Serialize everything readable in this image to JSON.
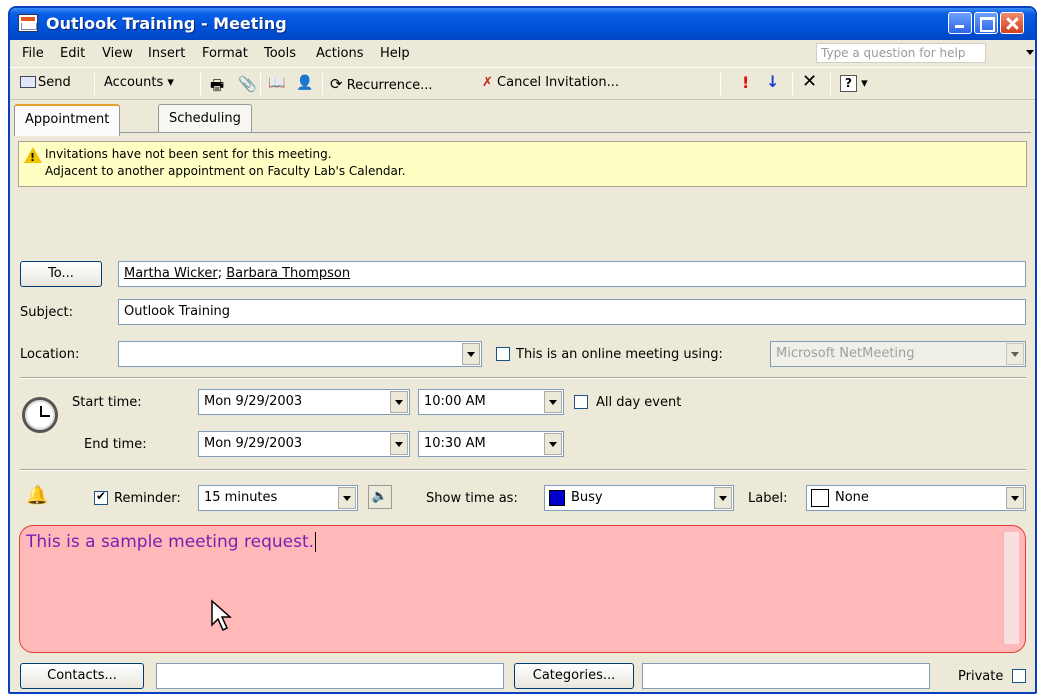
{
  "window": {
    "title": "Outlook Training - Meeting"
  },
  "menu": [
    "File",
    "Edit",
    "View",
    "Insert",
    "Format",
    "Tools",
    "Actions",
    "Help"
  ],
  "help_placeholder": "Type a question for help",
  "toolbar": {
    "send": "Send",
    "accounts": "Accounts",
    "recurrence": "Recurrence...",
    "cancel_invitation": "Cancel Invitation..."
  },
  "tabs": [
    "Appointment",
    "Scheduling"
  ],
  "info": {
    "line1": "Invitations have not been sent for this meeting.",
    "line2": "Adjacent to another appointment on Faculty Lab's Calendar."
  },
  "to": {
    "button": "To...",
    "recipients": [
      "Martha Wicker",
      "Barbara Thompson"
    ]
  },
  "subject": {
    "label": "Subject:",
    "value": "Outlook Training"
  },
  "location": {
    "label": "Location:",
    "value": "",
    "online_label": "This is an online meeting using:",
    "online_service": "Microsoft NetMeeting"
  },
  "start": {
    "label": "Start time:",
    "date": "Mon 9/29/2003",
    "time": "10:00 AM"
  },
  "end": {
    "label": "End time:",
    "date": "Mon 9/29/2003",
    "time": "10:30 AM"
  },
  "all_day": "All day event",
  "reminder": {
    "label": "Reminder:",
    "value": "15 minutes",
    "checked": true
  },
  "show_time_as": {
    "label": "Show time as:",
    "value": "Busy",
    "color": "#0000cc"
  },
  "label_field": {
    "label": "Label:",
    "value": "None"
  },
  "notes": "This is a sample meeting request.",
  "bottom": {
    "contacts": "Contacts...",
    "categories": "Categories...",
    "private": "Private"
  },
  "colors": {
    "notes_bg": "#ffb9b9",
    "notes_border": "#e53b3b",
    "notes_text": "#7a1fb3",
    "info_bg": "#ffffc4"
  }
}
